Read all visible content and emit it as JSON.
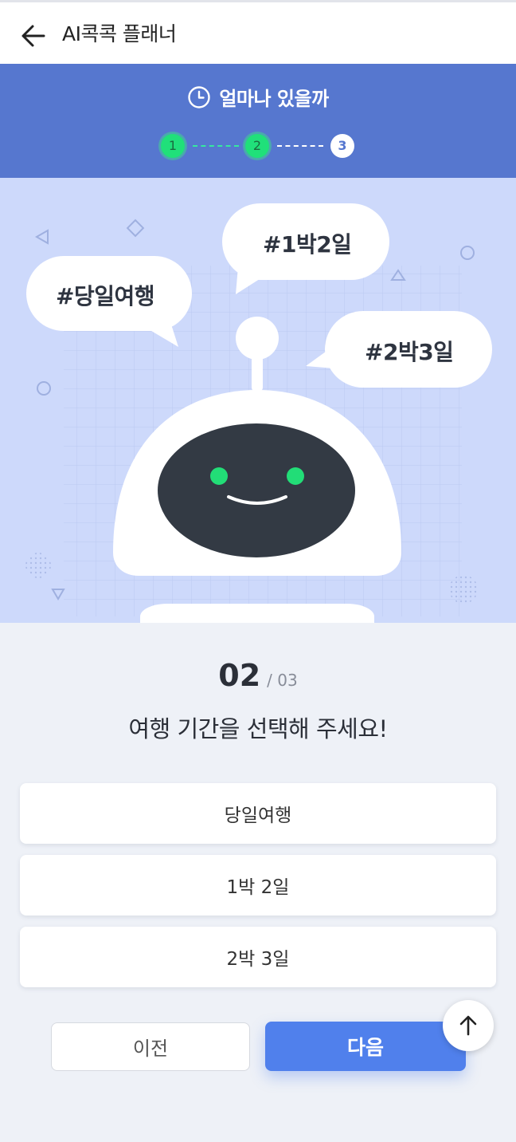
{
  "header": {
    "back_icon": "arrow-left-icon",
    "title": "AI콕콕 플래너"
  },
  "stepper": {
    "title": "얼마나 있을까",
    "title_icon": "clock-icon",
    "steps": [
      {
        "label": "1",
        "state": "done"
      },
      {
        "label": "2",
        "state": "done"
      },
      {
        "label": "3",
        "state": "current"
      }
    ],
    "colors": {
      "bar": "#5677cf",
      "done": "#20e07a"
    }
  },
  "hero": {
    "bubbles": [
      "#당일여행",
      "#1박2일",
      "#2박3일"
    ],
    "colors": {
      "background": "#cdd9fb",
      "robot_face": "#333a44",
      "eyes": "#22dd77"
    }
  },
  "question": {
    "current": "02",
    "total": "/ 03",
    "text": "여행 기간을 선택해 주세요!"
  },
  "options": [
    "당일여행",
    "1박 2일",
    "2박 3일"
  ],
  "buttons": {
    "prev": "이전",
    "next": "다음",
    "next_color": "#5080ec"
  },
  "scroll_top_icon": "arrow-up-icon"
}
